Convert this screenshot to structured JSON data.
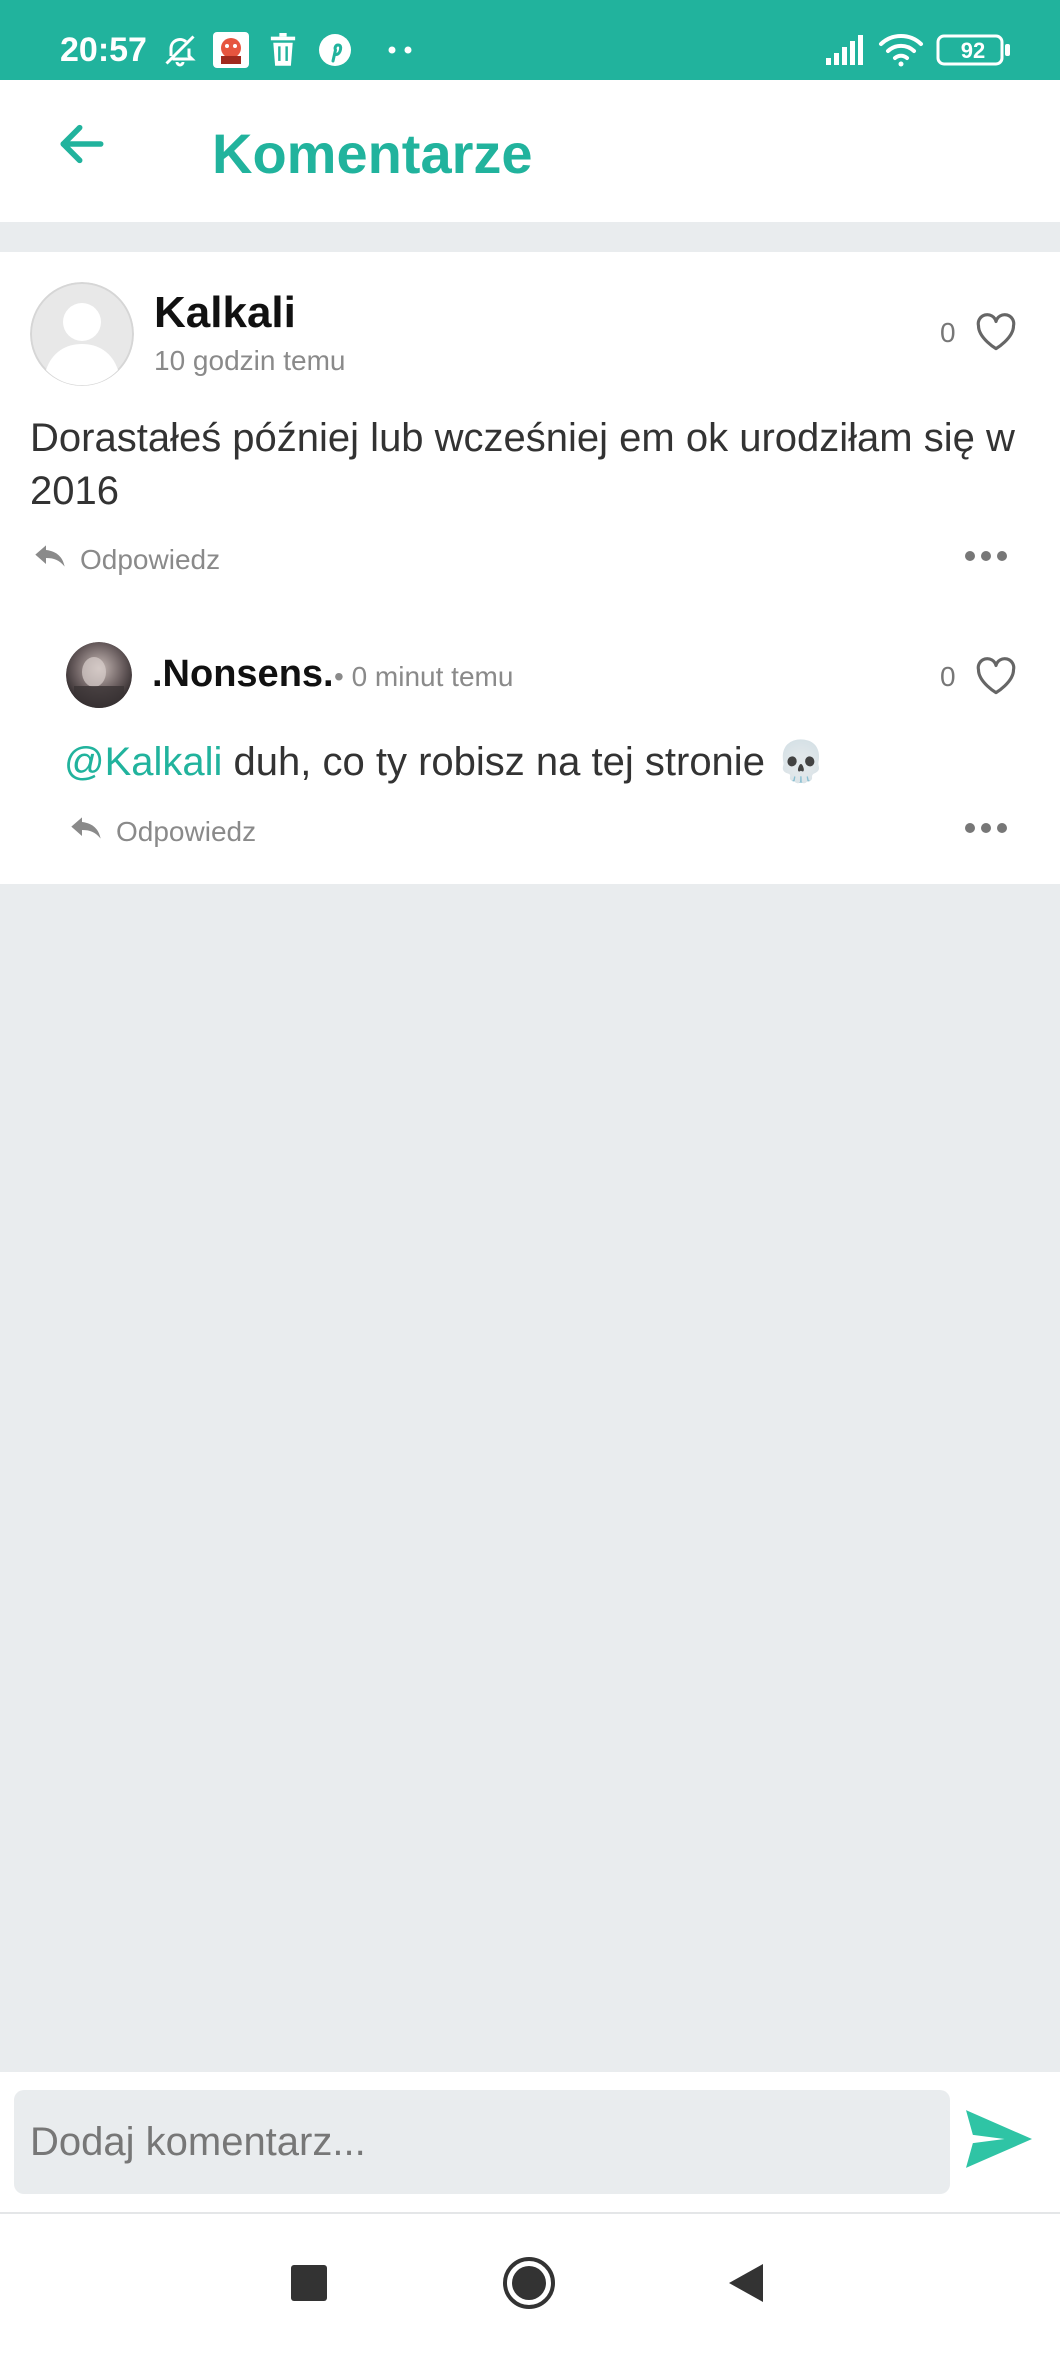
{
  "status_bar": {
    "time": "20:57",
    "battery": "92",
    "icons": [
      "muted-bell-icon",
      "app-notification-icon",
      "trash-icon",
      "pinterest-icon",
      "more-notifications-icon",
      "signal-icon",
      "wifi-icon",
      "battery-icon"
    ]
  },
  "header": {
    "title": "Komentarze",
    "back_icon": "arrow-left-icon"
  },
  "comment": {
    "author": "Kalkali",
    "time": "10 godzin temu",
    "likes": "0",
    "text": "Dorastałeś później lub wcześniej em ok urodziłam się w 2016",
    "reply_label": "Odpowiedz",
    "avatar": "default-avatar-icon"
  },
  "reply": {
    "author": ".Nonsens.",
    "time": "• 0 minut temu",
    "likes": "0",
    "mention": "@Kalkali",
    "text": " duh, co ty robisz na tej stronie 💀",
    "reply_label": "Odpowiedz",
    "avatar": "user-photo-avatar"
  },
  "composer": {
    "placeholder": "Dodaj komentarz..."
  },
  "colors": {
    "accent": "#21b39d",
    "page_background": "#e9ecee",
    "text": "#333333",
    "muted_text": "#8a8a8a"
  }
}
